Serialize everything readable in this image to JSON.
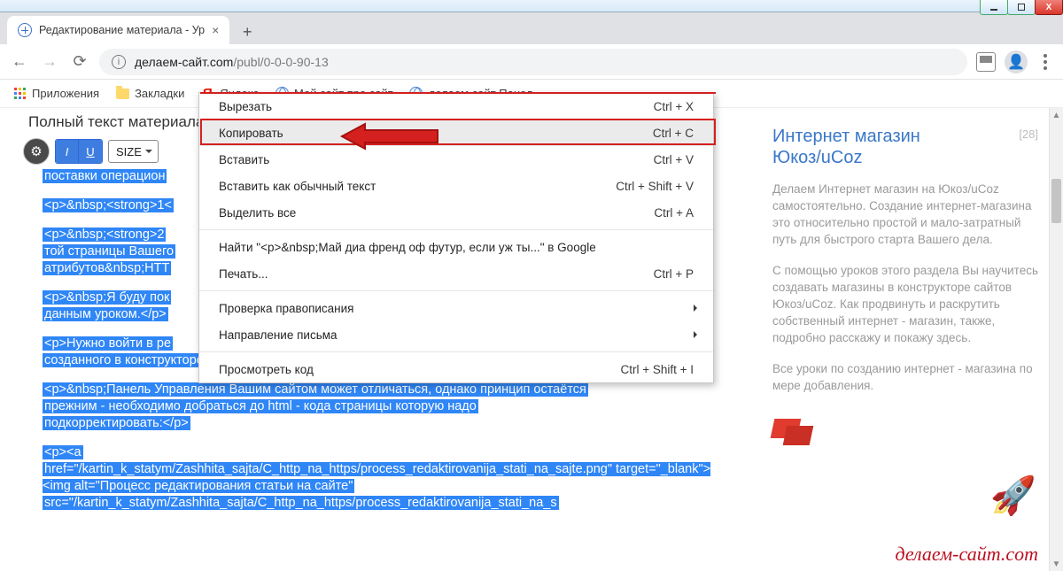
{
  "window": {
    "tab_title": "Редактирование материала - Ур"
  },
  "address": {
    "url_domain": "делаем-сайт.com",
    "url_path": "/publ/0-0-0-90-13"
  },
  "bookmarks": {
    "apps": "Приложения",
    "folder": "Закладки",
    "yandex": "Яндекс",
    "mysite": "Мой сайт про сайт",
    "panel": "делаем сайт Панел..."
  },
  "editor": {
    "heading": "Полный текст материала",
    "toolbar": {
      "size": "SIZE"
    },
    "selection": {
      "l1": "поставки операцион",
      "l2": "<p>&nbsp;<strong>1<",
      "l3a": "<p>&nbsp;<strong>2",
      "l3b": "той страницы Вашего",
      "l3c": "атрибутов&nbsp;HTT",
      "l4a": "<p>&nbsp;Я буду пок",
      "l4b": "данным уроком.</p>",
      "l5a": "<p>Нужно войти в ре",
      "l5b": "созданного в конструкторе uCoz.</p>",
      "l6a": "<p>&nbsp;Панель Управления Вашим сайтом может отличаться, однако принцип остаётся",
      "l6b": "прежним - необходимо добраться до html - кода страницы которую надо",
      "l6c": "подкорректировать:</p>",
      "l7a": "<p><a",
      "l7b": "href=\"/kartin_k_statym/Zashhita_sajta/C_http_na_https/process_redaktirovanija_stati_na_sajte.png\" target=\"_blank\"><img alt=\"Процесс редактирования статьи на сайте\"",
      "l7c": "src=\"/kartin_k_statym/Zashhita_sajta/C_http_na_https/process_redaktirovanija_stati_na_s"
    }
  },
  "context_menu": {
    "cut": "Вырезать",
    "cut_sc": "Ctrl + X",
    "copy": "Копировать",
    "copy_sc": "Ctrl + C",
    "paste": "Вставить",
    "paste_sc": "Ctrl + V",
    "paste_plain": "Вставить как обычный текст",
    "paste_plain_sc": "Ctrl + Shift + V",
    "select_all": "Выделить все",
    "select_all_sc": "Ctrl + A",
    "search": "Найти \"<p>&nbsp;Май диа френд оф футур, если уж ты...\" в Google",
    "print": "Печать...",
    "print_sc": "Ctrl + P",
    "spell": "Проверка правописания",
    "direction": "Направление письма",
    "inspect": "Просмотреть код",
    "inspect_sc": "Ctrl + Shift + I"
  },
  "sidebar": {
    "title_l1": "Интернет магазин",
    "title_l2": "Юкоз/uCoz",
    "count": "[28]",
    "p1": "Делаем Интернет магазин на Юкоз/uCoz самостоятельно. Создание интернет-магазина это относительно простой и мало-затратный путь для быстрого старта Вашего дела.",
    "p2": "С помощью уроков этого раздела Вы научитесь создавать магазины в конструкторе сайтов Юкоз/uCoz. Как продвинуть и раскрутить собственный интернет - магазин, также, подробно расскажу и покажу здесь.",
    "p3": "Все уроки по созданию интернет - магазина по мере добавления."
  },
  "watermark": "делаем-сайт.com"
}
